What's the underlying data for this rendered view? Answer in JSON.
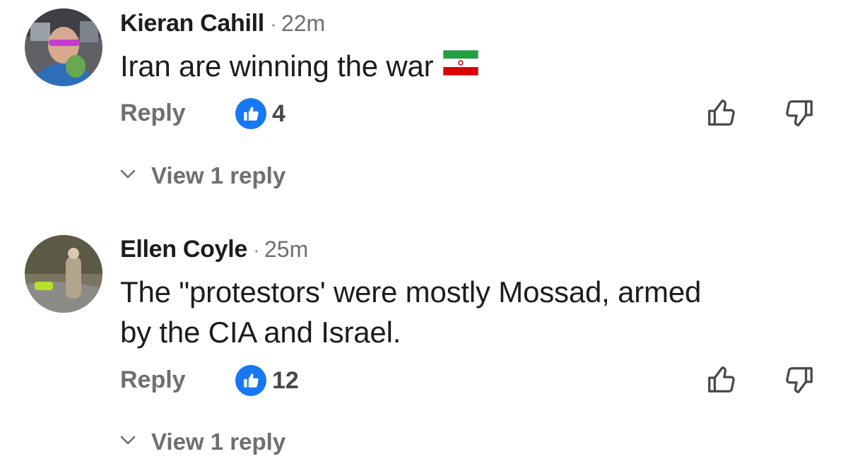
{
  "comments": [
    {
      "author": "Kieran Cahill",
      "separator": "·",
      "time": "22m",
      "text": "Iran are winning the war",
      "flag_icon": "iran-flag-icon",
      "reply_label": "Reply",
      "like_count": "4",
      "view_replies_label": "View 1 reply"
    },
    {
      "author": "Ellen Coyle",
      "separator": "·",
      "time": "25m",
      "text_line1": "The \"protestors' were mostly Mossad, armed",
      "text_line2": "by the CIA and Israel.",
      "reply_label": "Reply",
      "like_count": "12",
      "view_replies_label": "View 1 reply"
    }
  ],
  "colors": {
    "like_badge": "#1877f2",
    "meta_gray": "#6e6e73",
    "text": "#1c1c1e"
  },
  "icons": {
    "like_badge": "thumbs-up-icon",
    "thumb_up": "thumb-up-outline-icon",
    "thumb_down": "thumb-down-outline-icon",
    "expand": "chevron-down-icon"
  }
}
